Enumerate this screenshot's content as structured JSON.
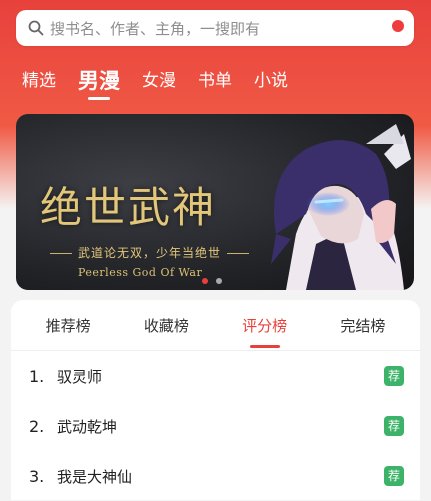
{
  "search": {
    "placeholder": "搜书名、作者、主角，一搜即有"
  },
  "nav": {
    "tabs": [
      {
        "label": "精选",
        "active": false
      },
      {
        "label": "男漫",
        "active": true
      },
      {
        "label": "女漫",
        "active": false
      },
      {
        "label": "书单",
        "active": false
      },
      {
        "label": "小说",
        "active": false
      }
    ]
  },
  "banner": {
    "title": "绝世武神",
    "subtitle": "武道论无双，少年当绝世",
    "english_title": "Peerless God Of War",
    "dots": [
      {
        "active": true
      },
      {
        "active": false
      }
    ]
  },
  "ranking": {
    "tabs": [
      {
        "label": "推荐榜",
        "active": false
      },
      {
        "label": "收藏榜",
        "active": false
      },
      {
        "label": "评分榜",
        "active": true
      },
      {
        "label": "完结榜",
        "active": false
      }
    ],
    "items": [
      {
        "num": "1.",
        "title": "驭灵师",
        "badge": "荐"
      },
      {
        "num": "2.",
        "title": "武动乾坤",
        "badge": "荐"
      },
      {
        "num": "3.",
        "title": "我是大神仙",
        "badge": "荐"
      }
    ]
  },
  "colors": {
    "accent": "#e8413c",
    "badge": "#3db36a",
    "banner_gold": "#e2c77a"
  }
}
